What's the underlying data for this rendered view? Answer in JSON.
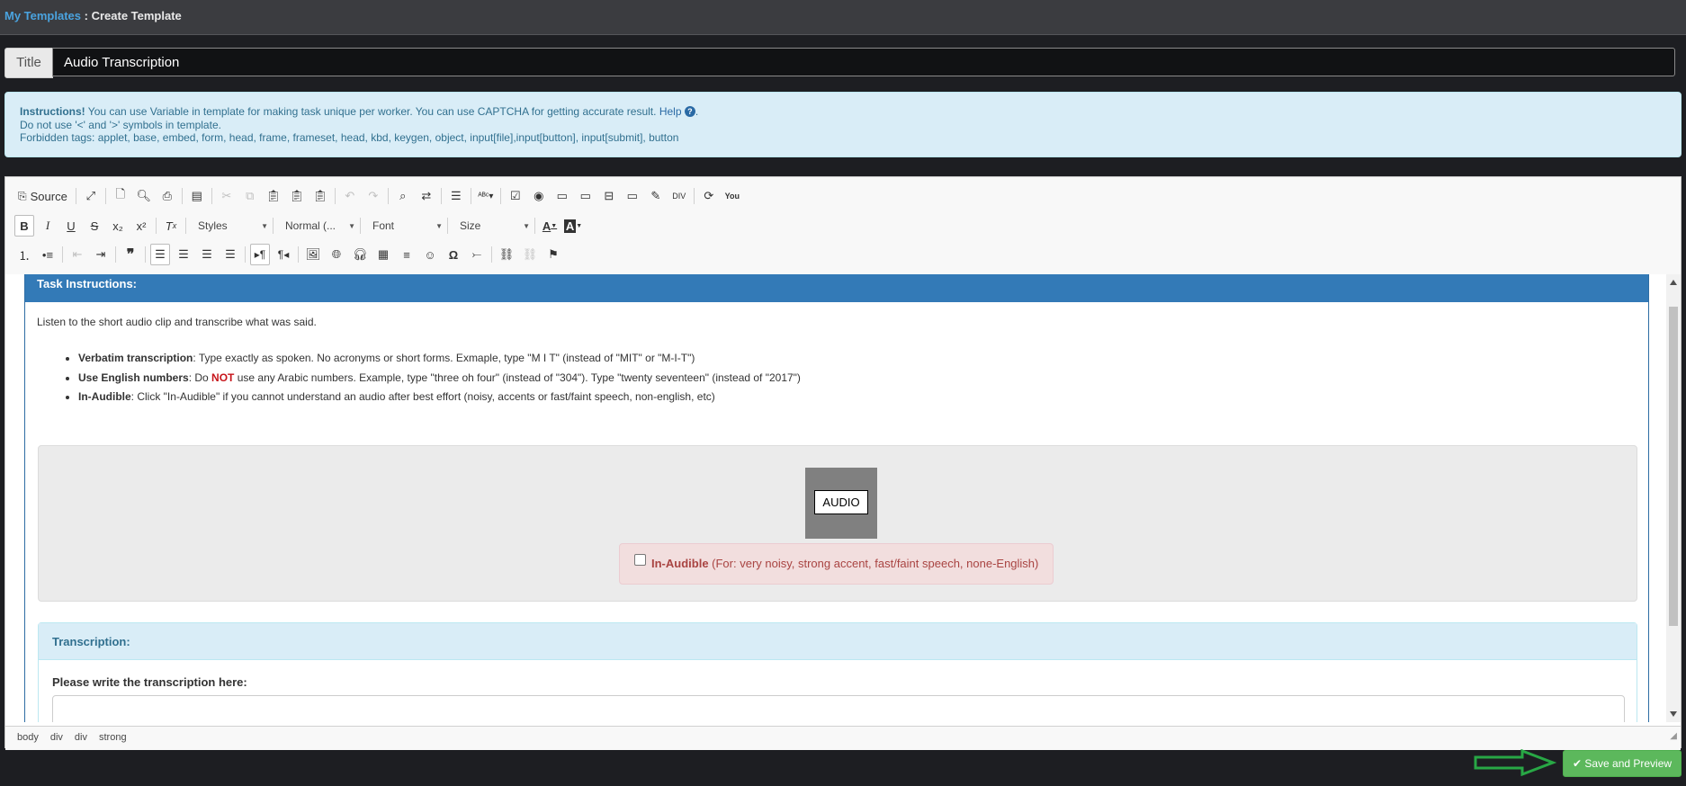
{
  "breadcrumb": {
    "link": "My Templates",
    "separator": " : ",
    "current": "Create Template"
  },
  "title_field": {
    "label": "Title",
    "value": "Audio Transcription"
  },
  "instructions": {
    "lead": "Instructions!",
    "line1": " You can use Variable in template for making task unique per worker. You can use CAPTCHA for getting accurate result. ",
    "help": "Help",
    "line2": "Do not use '<' and '>' symbols in template.",
    "line3": "Forbidden tags: applet, base, embed, form, head, frame, frameset, head, kbd, keygen, object, input[file],input[button], input[submit], button"
  },
  "toolbar": {
    "source": "Source",
    "styles": "Styles",
    "format": "Normal (...",
    "font": "Font",
    "size": "Size"
  },
  "task": {
    "heading": "Task Instructions:",
    "intro": "Listen to the short audio clip and transcribe what was said.",
    "bullets": [
      {
        "term": "Verbatim transcription",
        "text": ": Type exactly as spoken. No acronyms or short forms. Exmaple, type \"M I T\" (instead of \"MIT\" or \"M-I-T\")"
      },
      {
        "term": "Use English numbers",
        "pre": ": Do ",
        "emph": "NOT",
        "text": " use any Arabic numbers. Example, type \"three oh four\" (instead of \"304\"). Type \"twenty seventeen\" (instead of \"2017\")"
      },
      {
        "term": "In-Audible",
        "text": ": Click \"In-Audible\" if you cannot understand an audio after best effort (noisy, accents or fast/faint speech, non-english, etc)"
      }
    ],
    "audio_label": "AUDIO",
    "inaudible_label": "In-Audible",
    "inaudible_note": " (For: very noisy, strong accent, fast/faint speech, none-English)",
    "transcription_heading": "Transcription:",
    "transcription_prompt": "Please write the transcription here:"
  },
  "element_path": [
    "body",
    "div",
    "div",
    "strong"
  ],
  "save_button": "Save and Preview",
  "colors": {
    "primary": "#337ab7",
    "success": "#5cb85c",
    "info_bg": "#d9edf7",
    "danger_bg": "#f2dede",
    "arrow": "#28a745"
  }
}
